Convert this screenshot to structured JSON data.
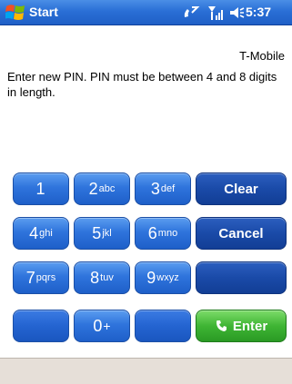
{
  "titlebar": {
    "start_label": "Start",
    "time": "5:37",
    "icons": [
      "windows-flag-icon",
      "phone-connection-icon",
      "signal-strength-icon",
      "speaker-volume-icon"
    ]
  },
  "carrier": "T-Mobile",
  "instructions": "Enter new PIN. PIN must be between 4 and 8 digits in length.",
  "keypad": {
    "keys": [
      {
        "digit": "1",
        "letters": ""
      },
      {
        "digit": "2",
        "letters": "abc"
      },
      {
        "digit": "3",
        "letters": "def"
      },
      {
        "digit": "4",
        "letters": "ghi"
      },
      {
        "digit": "5",
        "letters": "jkl"
      },
      {
        "digit": "6",
        "letters": "mno"
      },
      {
        "digit": "7",
        "letters": "pqrs"
      },
      {
        "digit": "8",
        "letters": "tuv"
      },
      {
        "digit": "9",
        "letters": "wxyz"
      },
      {
        "digit": "0",
        "letters": "+"
      }
    ],
    "clear_label": "Clear",
    "cancel_label": "Cancel",
    "enter_label": "Enter"
  },
  "colors": {
    "titlebar": "#2a6fd6",
    "key_blue": "#2f74dc",
    "key_action": "#1a4aa8",
    "key_enter": "#3fb534",
    "bottombar": "#e6dfd8"
  }
}
